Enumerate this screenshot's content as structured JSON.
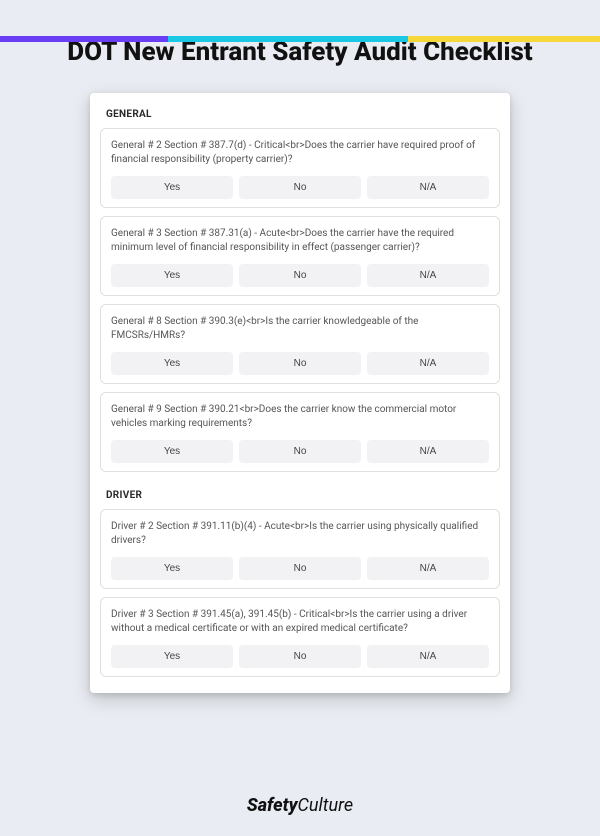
{
  "title": "DOT New Entrant Safety Audit Checklist",
  "answers": {
    "yes": "Yes",
    "no": "No",
    "na": "N/A"
  },
  "sections": [
    {
      "header": "GENERAL",
      "questions": [
        "General # 2 Section # 387.7(d) - Critical<br>Does the carrier have required proof of financial responsibility (property carrier)?",
        "General # 3 Section # 387.31(a) - Acute<br>Does the carrier have the required minimum level of financial responsibility in effect (passenger carrier)?",
        "General # 8 Section # 390.3(e)<br>Is the carrier knowledgeable of the FMCSRs/HMRs?",
        "General # 9 Section # 390.21<br>Does the carrier know the commercial motor vehicles marking requirements?"
      ]
    },
    {
      "header": "DRIVER",
      "questions": [
        "Driver # 2 Section # 391.11(b)(4) - Acute<br>Is the carrier using physically qualified drivers?",
        "Driver # 3 Section # 391.45(a), 391.45(b) - Critical<br>Is the carrier using a driver without a medical certificate or with an expired medical certificate?"
      ]
    }
  ],
  "footer": {
    "brand_bold": "Safety",
    "brand_light": "Culture"
  }
}
